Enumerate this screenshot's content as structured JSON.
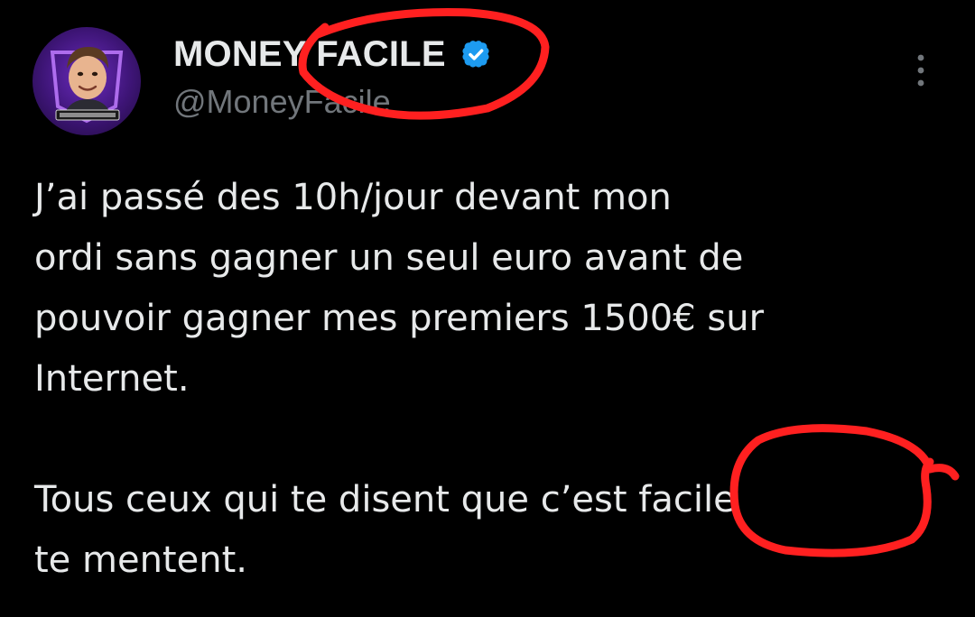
{
  "author": {
    "display_name": "MONEY FACILE",
    "handle": "@MoneyFacile",
    "avatar_icon": "profile-avatar",
    "verified_icon": "verified-badge-icon",
    "verified_color": "#1d9bf0"
  },
  "menu": {
    "icon": "more-options-icon"
  },
  "tweet": {
    "paragraphs": [
      {
        "lines": [
          "J’ai passé des 10h/jour devant mon",
          "ordi sans gagner un seul euro avant de",
          "pouvoir gagner mes premiers 1500€ sur",
          "Internet."
        ]
      },
      {
        "lines": [
          "Tous ceux qui te disent que c’est facile",
          "te mentent."
        ]
      }
    ]
  },
  "annotations": {
    "color": "#ff2020"
  },
  "colors": {
    "background": "#000000",
    "text": "#e7e9ea",
    "secondary_text": "#71767b"
  }
}
